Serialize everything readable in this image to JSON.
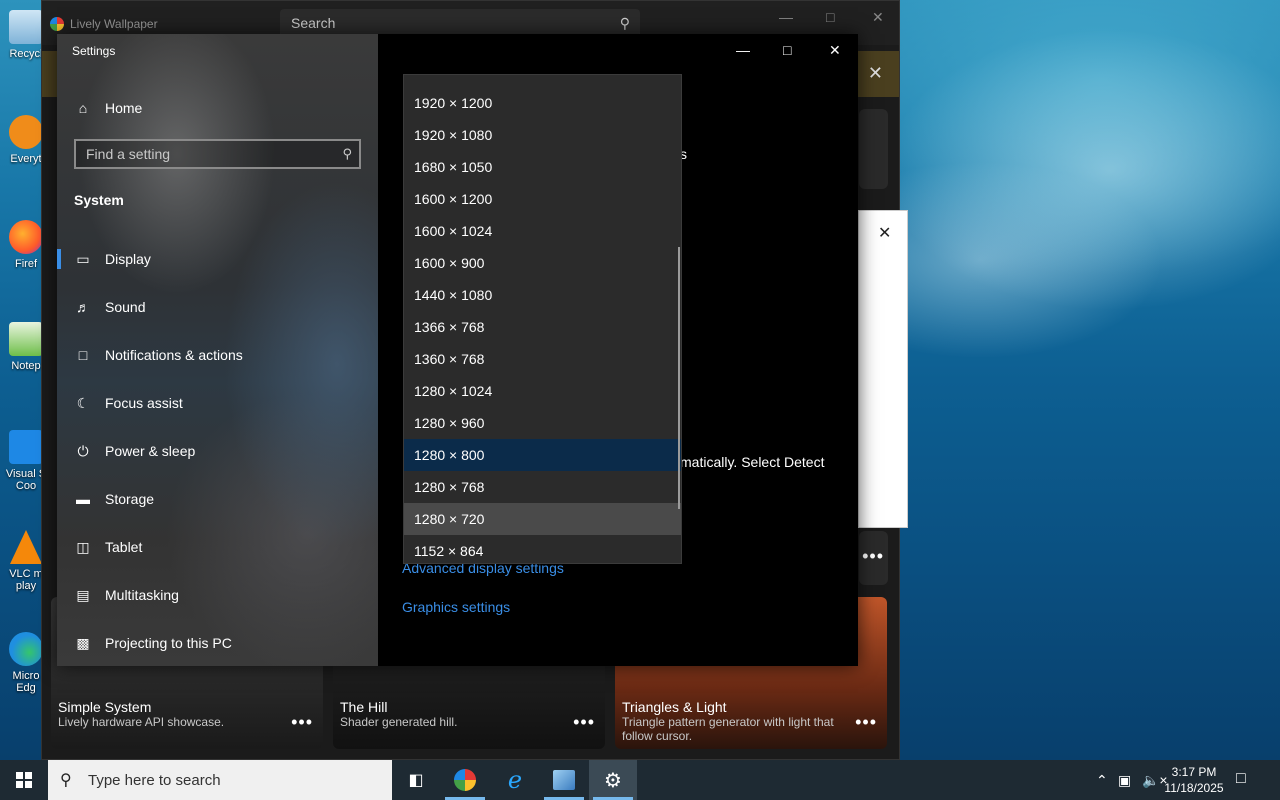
{
  "desktop": {
    "icons": [
      {
        "label": "Recycl",
        "color": "#5aa0d0"
      },
      {
        "label": "Everyt",
        "color": "#f08c1a"
      },
      {
        "label": "Firef",
        "color": "#ff6a2b"
      },
      {
        "label": "Notep",
        "color": "#6fbf4a"
      },
      {
        "label": "Visual S Coo",
        "color": "#1e88e5"
      },
      {
        "label": "VLC m play",
        "color": "#f5880a"
      },
      {
        "label": "Micro Edg",
        "color": "#1f8fe0"
      }
    ]
  },
  "lively": {
    "title": "Lively Wallpaper",
    "search_text": "Search",
    "search_icon": "search-icon",
    "banner_close": "✕",
    "tiles": [
      {
        "title": "Simple System",
        "desc": "Lively hardware API showcase.",
        "more": "•••"
      },
      {
        "title": "The Hill",
        "desc": "Shader generated hill.",
        "more": "•••"
      },
      {
        "title": "Triangles & Light",
        "desc": "Triangle pattern generator with light that follow cursor.",
        "more": "•••"
      }
    ],
    "side_more_1": "•••"
  },
  "settings": {
    "title": "Settings",
    "home": "Home",
    "find_placeholder": "Find a setting",
    "section": "System",
    "nav": [
      {
        "label": "Display",
        "icon": "monitor-icon",
        "active": true
      },
      {
        "label": "Sound",
        "icon": "speaker-icon"
      },
      {
        "label": "Notifications & actions",
        "icon": "notification-icon"
      },
      {
        "label": "Focus assist",
        "icon": "moon-icon"
      },
      {
        "label": "Power & sleep",
        "icon": "power-icon"
      },
      {
        "label": "Storage",
        "icon": "storage-icon"
      },
      {
        "label": "Tablet",
        "icon": "tablet-icon"
      },
      {
        "label": "Multitasking",
        "icon": "multitasking-icon"
      },
      {
        "label": "Projecting to this PC",
        "icon": "projector-icon"
      }
    ],
    "content_fragment_1": "s",
    "content_fragment_2": "matically. Select Detect",
    "links": {
      "advanced": "Advanced display settings",
      "graphics": "Graphics settings"
    }
  },
  "resolution_dropdown": {
    "selected": "1280 × 800",
    "hovered": "1280 × 720",
    "options": [
      "1920 × 1200",
      "1920 × 1080",
      "1680 × 1050",
      "1600 × 1200",
      "1600 × 1024",
      "1600 × 900",
      "1440 × 1080",
      "1366 × 768",
      "1360 × 768",
      "1280 × 1024",
      "1280 × 960",
      "1280 × 800",
      "1280 × 768",
      "1280 × 720",
      "1152 × 864"
    ]
  },
  "taskbar": {
    "search_placeholder": "Type here to search",
    "time": "3:17 PM",
    "date": "11/18/2025"
  },
  "colors": {
    "accent": "#3a8ee6",
    "selected_bg": "#0b2b4a"
  }
}
